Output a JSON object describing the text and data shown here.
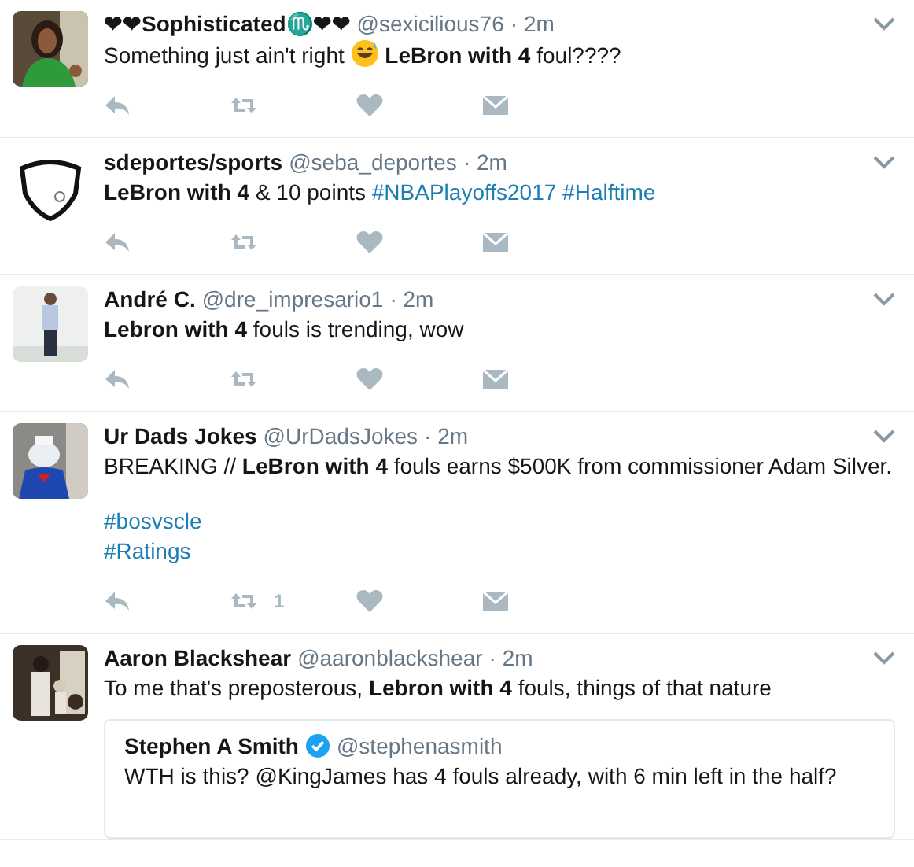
{
  "tweets": [
    {
      "name": "❤❤Sophisticated♏❤❤",
      "handle": "@sexicilious76",
      "time": "· 2m",
      "paragraphs": [
        [
          {
            "kind": "text",
            "value": "Something just ain't right"
          },
          {
            "kind": "emoji"
          },
          {
            "kind": "text",
            "value": "**LeBron with 4** foul????"
          }
        ]
      ]
    },
    {
      "name": "sdeportes/sports",
      "handle": "@seba_deportes",
      "time": "· 2m",
      "paragraphs": [
        [
          {
            "kind": "text",
            "value": "**LeBron with 4** & 10 points"
          },
          {
            "kind": "hashtag",
            "value": "#NBAPlayoffs2017"
          },
          {
            "kind": "hashtag",
            "value": "#Halftime"
          }
        ]
      ]
    },
    {
      "name": "André C.",
      "handle": "@dre_impresario1",
      "time": "· 2m",
      "paragraphs": [
        [
          {
            "kind": "text",
            "value": "**Lebron with 4** fouls is trending, wow"
          }
        ]
      ]
    },
    {
      "name": "Ur Dads Jokes",
      "handle": "@UrDadsJokes",
      "time": "· 2m",
      "paragraphs": [
        [
          {
            "kind": "text",
            "value": "BREAKING // **LeBron with 4** fouls earns $500K from commissioner Adam Silver."
          }
        ],
        [
          {
            "kind": "hashtag_line",
            "value": "#bosvscle"
          },
          {
            "kind": "hashtag_line",
            "value": "#Ratings"
          }
        ]
      ],
      "retweets": "1"
    },
    {
      "name": "Aaron Blackshear",
      "handle": "@aaronblackshear",
      "time": "· 2m",
      "paragraphs": [
        [
          {
            "kind": "text",
            "value": "To me that's preposterous, **Lebron with 4** fouls, things of that nature"
          }
        ]
      ],
      "quote": {
        "name": "Stephen A Smith",
        "verified": true,
        "handle": "@stephenasmith",
        "text": "WTH is this? @KingJames has 4 fouls already, with 6 min left in the half?"
      }
    }
  ]
}
